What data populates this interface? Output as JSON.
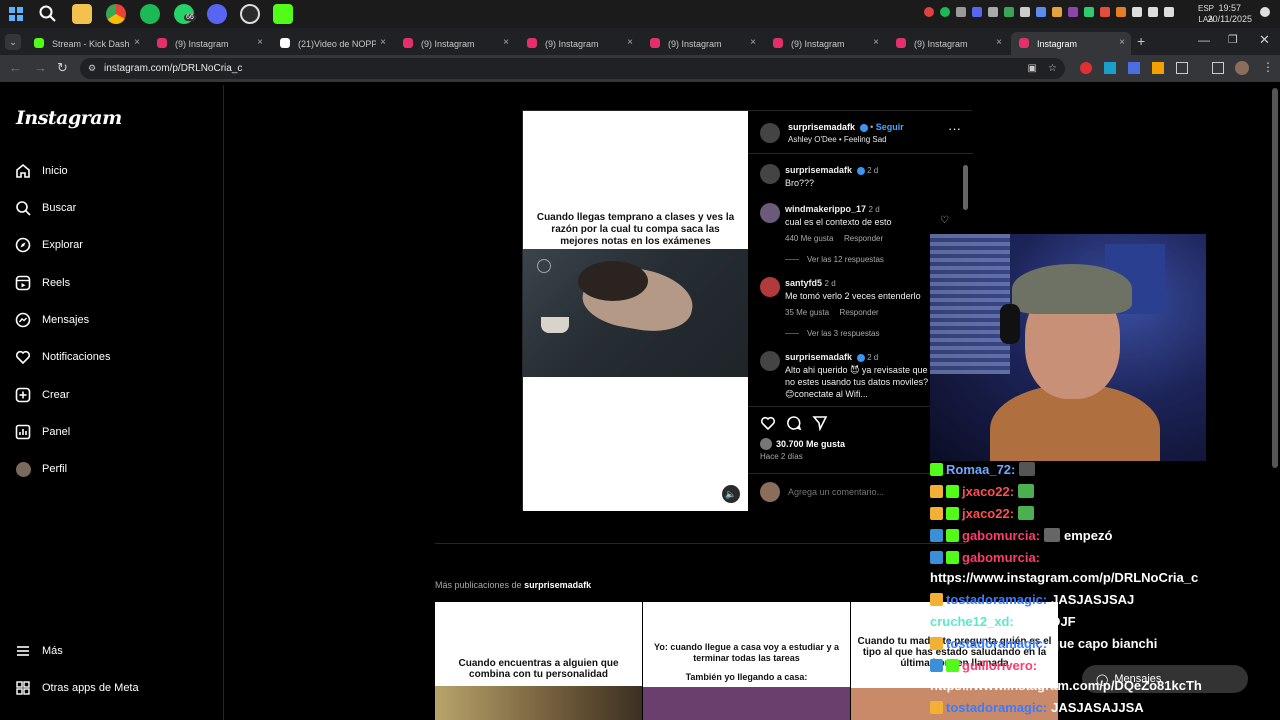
{
  "taskbar": {
    "lang_top": "ESP",
    "lang_bottom": "LAA",
    "time": "19:57",
    "date": "20/11/2025",
    "whatsapp_badge": "66"
  },
  "tabs": [
    {
      "label": "Stream - Kick Dashboard",
      "color": "#53fc18"
    },
    {
      "label": "(9) Instagram",
      "color": "#e1306c"
    },
    {
      "label": "(21)Video de NOPP...",
      "color": "#ffffff"
    },
    {
      "label": "(9) Instagram",
      "color": "#e1306c"
    },
    {
      "label": "(9) Instagram",
      "color": "#e1306c"
    },
    {
      "label": "(9) Instagram",
      "color": "#e1306c"
    },
    {
      "label": "(9) Instagram",
      "color": "#e1306c"
    },
    {
      "label": "(9) Instagram",
      "color": "#e1306c"
    },
    {
      "label": "Instagram",
      "color": "#e1306c"
    }
  ],
  "address": {
    "url": "instagram.com/p/DRLNoCria_c"
  },
  "sidebar": {
    "logo": "Instagram",
    "items": [
      {
        "label": "Inicio",
        "icon": "home-icon"
      },
      {
        "label": "Buscar",
        "icon": "search-icon"
      },
      {
        "label": "Explorar",
        "icon": "compass-icon"
      },
      {
        "label": "Reels",
        "icon": "reels-icon"
      },
      {
        "label": "Mensajes",
        "icon": "messenger-icon"
      },
      {
        "label": "Notificaciones",
        "icon": "heart-icon"
      },
      {
        "label": "Crear",
        "icon": "plus-square-icon"
      },
      {
        "label": "Panel",
        "icon": "chart-icon"
      },
      {
        "label": "Perfil",
        "icon": "avatar-icon"
      }
    ],
    "more": "Más",
    "meta_apps": "Otras apps de Meta"
  },
  "post": {
    "meme_text": "Cuando llegas temprano a clases y ves la razón por la cual tu compa saca las mejores notas en los exámenes",
    "header": {
      "username": "surprisemadafk",
      "follow": "Seguir",
      "separator": "•",
      "audio": "Ashley O'Dee • Feeling Sad"
    },
    "comments": [
      {
        "user": "surprisemadafk",
        "verified": true,
        "time": "2 d",
        "text": "Bro???",
        "likes": "",
        "reply": ""
      },
      {
        "user": "windmakerippo_17",
        "verified": false,
        "time": "2 d",
        "text": "cual es el contexto de esto",
        "likes": "440 Me gusta",
        "reply": "Responder",
        "more": "Ver las 12 respuestas"
      },
      {
        "user": "santyfd5",
        "verified": false,
        "time": "2 d",
        "text": "Me tomó verlo 2 veces entenderlo",
        "likes": "35 Me gusta",
        "reply": "Responder",
        "more": "Ver las 3 respuestas"
      },
      {
        "user": "surprisemadafk",
        "verified": true,
        "time": "2 d",
        "text": "Alto ahi querido 😈 ya revisaste que no estes usando tus datos moviles? 😊conectate al Wifi...",
        "likes": "",
        "reply": ""
      }
    ],
    "likes": "30.700 Me gusta",
    "time_ago": "Hace 2 días",
    "comment_placeholder": "Agrega un comentario..."
  },
  "more_posts": {
    "title_prefix": "Más publicaciones de ",
    "title_user": "surprisemadafk",
    "thumbs": [
      {
        "caption": "Cuando encuentras a alguien que combina con tu personalidad"
      },
      {
        "caption": "Yo: cuando llegue a casa voy a estudiar y a terminar todas las tareas",
        "caption2": "También yo llegando a casa:"
      },
      {
        "caption": "Cuando tu madre te pregunta quién es el tipo al que has estado saludando en la última hora en llamada"
      }
    ]
  },
  "chat": {
    "lines": [
      {
        "user": "Romaa_72:",
        "color": "#6fa8ff",
        "text": ""
      },
      {
        "user": "jxaco22:",
        "color": "#ff4f4f",
        "text": ""
      },
      {
        "user": "jxaco22:",
        "color": "#ff4f4f",
        "text": ""
      },
      {
        "user": "gabomurcia:",
        "color": "#ff3b6b",
        "text": "empezó"
      },
      {
        "user": "gabomurcia:",
        "color": "#ff3b6b",
        "text": ""
      },
      {
        "user": "",
        "color": "#ffffff",
        "text": "https://www.instagram.com/p/DRLNoCria_c"
      },
      {
        "user": "tostadoramagic:",
        "color": "#3a7bff",
        "text": "JASJASJSAJ"
      },
      {
        "user": "cruche12_xd:",
        "color": "#5ee8c8",
        "text": "JHFSDJF"
      },
      {
        "user": "tostadoramagic:",
        "color": "#3a7bff",
        "text": "que capo bianchi"
      },
      {
        "user": "guillorivero:",
        "color": "#ff3b6b",
        "text": ""
      },
      {
        "user": "",
        "color": "#ffffff",
        "text": "https://www.instagram.com/p/DQeZo81kcTh"
      },
      {
        "user": "tostadoramagic:",
        "color": "#3a7bff",
        "text": "JASJASAJJSA"
      }
    ],
    "overlay_label": "Mensajes"
  }
}
